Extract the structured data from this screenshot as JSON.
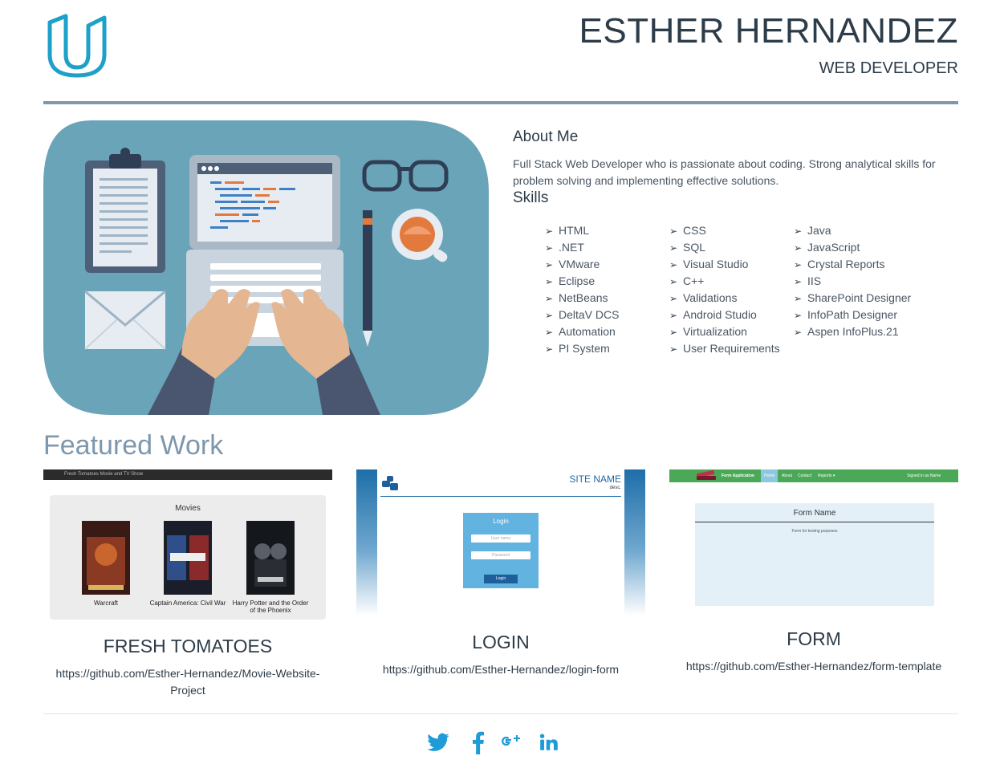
{
  "header": {
    "name": "ESTHER HERNANDEZ",
    "title": "WEB DEVELOPER"
  },
  "about": {
    "heading": "About Me",
    "text": "Full Stack Web Developer who is passionate about coding. Strong analytical skills for problem solving and implementing effective solutions.",
    "skills_heading": "Skills",
    "bullet": "➢",
    "skills": [
      [
        "HTML",
        ".NET",
        "VMware",
        "Eclipse",
        "NetBeans",
        "DeltaV DCS",
        "Automation",
        "PI System"
      ],
      [
        "CSS",
        "SQL",
        "Visual Studio",
        "C++",
        "Validations",
        "Android Studio",
        "Virtualization",
        "User Requirements"
      ],
      [
        "Java",
        "JavaScript",
        "Crystal Reports",
        "IIS",
        "SharePoint Designer",
        "InfoPath Designer",
        "Aspen InfoPlus.21"
      ]
    ]
  },
  "featured": {
    "heading": "Featured Work",
    "projects": [
      {
        "title": "FRESH TOMATOES",
        "link": "https://github.com/Esther-Hernandez/Movie-Website-Project",
        "screenshot": {
          "bar_text": "Fresh Tomatoes Movie and TV Show",
          "section_title": "Movies",
          "movies": [
            "Warcraft",
            "Captain America: Civil War",
            "Harry Potter and the Order of the Phoenix"
          ]
        }
      },
      {
        "title": "LOGIN",
        "link": "https://github.com/Esther-Hernandez/login-form",
        "screenshot": {
          "site_name": "SITE NAME",
          "desc": "desc.",
          "box_title": "Login",
          "username_placeholder": "User name",
          "password_placeholder": "Password",
          "button": "Login"
        }
      },
      {
        "title": "FORM",
        "link": "https://github.com/Esther-Hernandez/form-template",
        "screenshot": {
          "brand": "Form Application",
          "nav": [
            "Home",
            "About",
            "Contact",
            "Reports ▾"
          ],
          "signed_in": "Signed in as Name",
          "form_name": "Form Name",
          "form_desc": "Form for testing purposes"
        }
      }
    ]
  },
  "social": [
    "twitter-icon",
    "facebook-icon",
    "google-plus-icon",
    "linkedin-icon"
  ],
  "colors": {
    "text": "#2d3c49",
    "accent": "#7d97ad",
    "logo": "#1ea0c9",
    "social": "#1f9bd8"
  }
}
